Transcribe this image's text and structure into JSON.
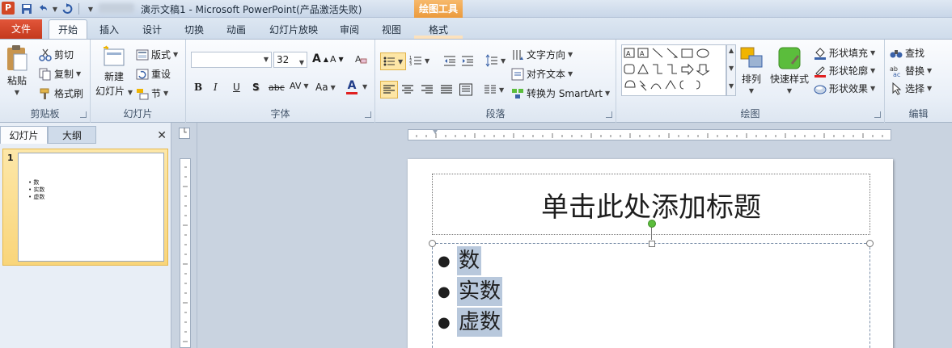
{
  "window": {
    "app_icon": "P",
    "title": "演示文稿1 - Microsoft PowerPoint(产品激活失败)",
    "context_header": "绘图工具"
  },
  "qat": [
    "save-icon",
    "undo-icon",
    "redo-icon",
    "customize-icon"
  ],
  "tabs": [
    {
      "label": "文件"
    },
    {
      "label": "开始"
    },
    {
      "label": "插入"
    },
    {
      "label": "设计"
    },
    {
      "label": "切换"
    },
    {
      "label": "动画"
    },
    {
      "label": "幻灯片放映"
    },
    {
      "label": "审阅"
    },
    {
      "label": "视图"
    },
    {
      "label": "格式"
    }
  ],
  "clipboard": {
    "paste": "粘贴",
    "cut": "剪切",
    "copy": "复制",
    "format_painter": "格式刷",
    "label": "剪贴板"
  },
  "slides_group": {
    "new_slide_1": "新建",
    "new_slide_2": "幻灯片",
    "layout": "版式",
    "reset": "重设",
    "section": "节",
    "label": "幻灯片"
  },
  "font": {
    "family": "",
    "size": "32",
    "label": "字体",
    "bold": "B",
    "italic": "I",
    "underline": "U",
    "shadow": "S",
    "strike": "abc",
    "spacing": "AV",
    "case": "Aa",
    "color": "A",
    "grow": "A",
    "shrink": "A"
  },
  "paragraph": {
    "text_direction": "文字方向",
    "align_text": "对齐文本",
    "smartart": "转换为 SmartArt",
    "label": "段落"
  },
  "drawing": {
    "arrange": "排列",
    "quick_styles": "快速样式",
    "shape_fill": "形状填充",
    "shape_outline": "形状轮廓",
    "shape_effects": "形状效果",
    "label": "绘图"
  },
  "editing": {
    "find": "查找",
    "replace": "替换",
    "select": "选择",
    "label": "编辑"
  },
  "panel": {
    "tab_slides": "幻灯片",
    "tab_outline": "大纲",
    "close": "✕",
    "thumbnail_number": "1",
    "thumbnail_items": [
      "数",
      "实数",
      "虚数"
    ]
  },
  "slide": {
    "title": "单击此处添加标题",
    "bullets": [
      "数",
      "实数",
      "虚数"
    ]
  },
  "colors": {
    "file_tab": "#d24726",
    "context_tab": "#eb9a3c",
    "selection": "#b8c8dc",
    "thumb_selected": "#f9d57a"
  }
}
